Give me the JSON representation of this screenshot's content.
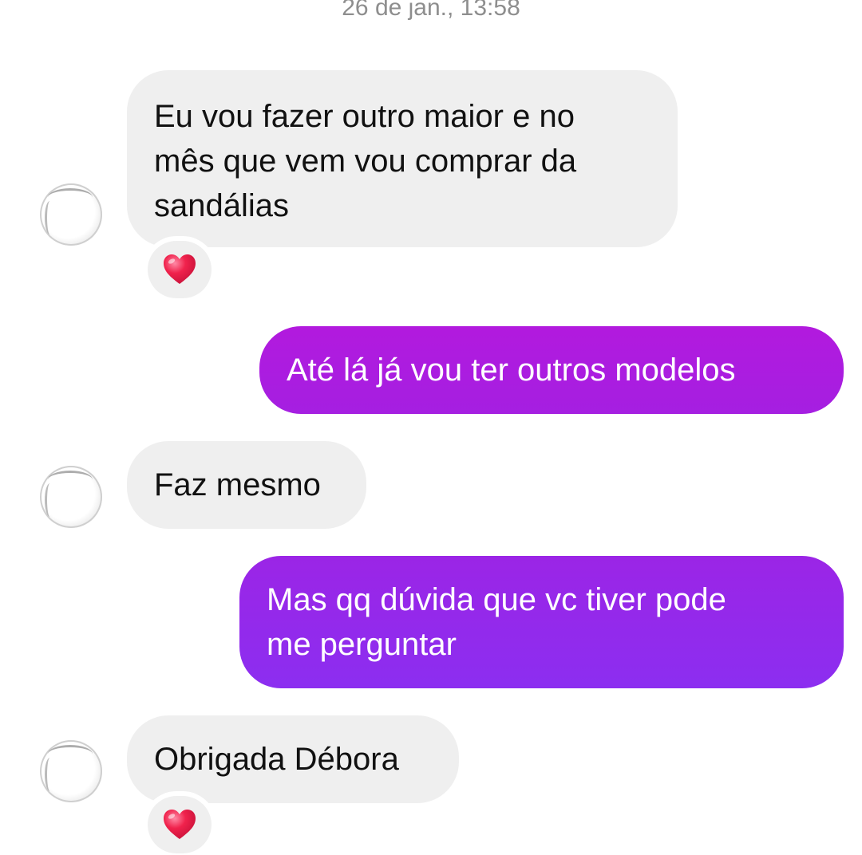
{
  "timestamp": "26 de jan., 13:58",
  "colors": {
    "incoming_bubble": "#efefef",
    "outgoing_top": "#b219de",
    "outgoing_bottom": "#8b2ef0",
    "reaction_heart": "#f0224c",
    "timestamp_text": "#8e8e8e"
  },
  "messages": [
    {
      "direction": "incoming",
      "lines": [
        "Eu vou fazer outro maior e no",
        "mês que vem vou comprar da",
        "sandálias"
      ],
      "reaction": "red-heart"
    },
    {
      "direction": "outgoing",
      "lines": [
        "Até lá já vou ter outros modelos"
      ]
    },
    {
      "direction": "incoming",
      "lines": [
        "Faz mesmo"
      ]
    },
    {
      "direction": "outgoing",
      "lines": [
        "Mas qq dúvida que vc tiver pode",
        "me perguntar"
      ]
    },
    {
      "direction": "incoming",
      "lines": [
        "Obrigada Débora"
      ],
      "reaction": "red-heart"
    }
  ]
}
